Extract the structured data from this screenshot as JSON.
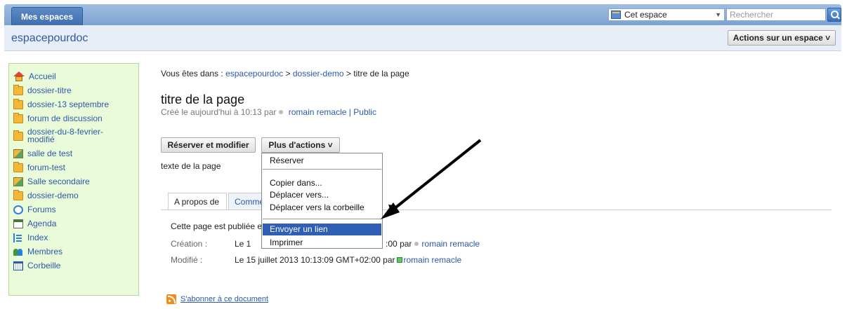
{
  "topbar": {
    "tab_label": "Mes espaces",
    "scope_select": "Cet espace",
    "search_placeholder": "Rechercher"
  },
  "space": {
    "title": "espacepourdoc",
    "actions_label": "Actions sur un espace ˅"
  },
  "sidebar": {
    "items": [
      {
        "label": "Accueil",
        "icon": "home-icon"
      },
      {
        "label": "dossier-titre",
        "icon": "folder-icon"
      },
      {
        "label": "dossier-13 septembre",
        "icon": "folder-icon"
      },
      {
        "label": "forum de discussion",
        "icon": "folder-icon"
      },
      {
        "label": "dossier-du-8-fevrier-modifié",
        "icon": "folder-icon"
      },
      {
        "label": "salle de test",
        "icon": "room-icon"
      },
      {
        "label": "forum-test",
        "icon": "folder-icon"
      },
      {
        "label": "Salle secondaire",
        "icon": "room-icon"
      },
      {
        "label": "dossier-demo",
        "icon": "folder-icon"
      },
      {
        "label": "Forums",
        "icon": "forum-icon"
      },
      {
        "label": "Agenda",
        "icon": "calendar-icon"
      },
      {
        "label": "Index",
        "icon": "index-icon"
      },
      {
        "label": "Membres",
        "icon": "members-icon"
      },
      {
        "label": "Corbeille",
        "icon": "trash-icon"
      }
    ]
  },
  "breadcrumb": {
    "prefix": "Vous êtes dans :",
    "crumb1": "espacepourdoc",
    "sep": ">",
    "crumb2": "dossier-demo",
    "current": "titre de la page"
  },
  "page": {
    "title": "titre de la page",
    "created_prefix": "Créé le aujourd'hui à 10:13 par",
    "author": "romain remacle",
    "pipe": "|",
    "visibility": "Public",
    "text": "texte de la page"
  },
  "buttons": {
    "reserve": "Réserver et modifier",
    "more": "Plus d'actions ˅"
  },
  "menu": {
    "items": [
      "Réserver",
      "Copier dans...",
      "Déplacer vers...",
      "Déplacer vers la corbeille",
      "Envoyer un lien",
      "Imprimer"
    ],
    "highlighted": "Envoyer un lien"
  },
  "tabs": {
    "about": "A propos de",
    "comments": "Comme"
  },
  "about": {
    "published": "Cette page est publiée e",
    "creation_label": "Création :",
    "creation_date": "Le 1",
    "creation_tail": ":00 par",
    "creation_author": "romain remacle",
    "modified_label": "Modifié :",
    "modified_date": "Le 15 juillet 2013 10:13:09 GMT+02:00 par",
    "modified_author": "romain remacle"
  },
  "footer": {
    "rss_link": "S'abonner à ce document"
  },
  "colors": {
    "highlight": "#2f5fb4",
    "link": "#2b5aa8",
    "sidebar_bg": "#e9fbd9"
  }
}
